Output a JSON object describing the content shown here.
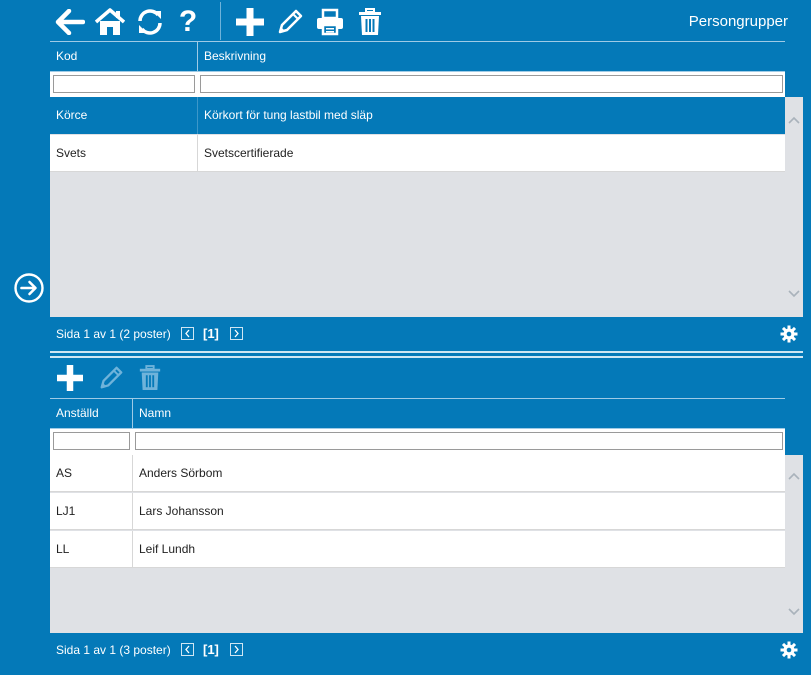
{
  "window": {
    "title": "Persongrupper"
  },
  "toolbar": {
    "buttons": [
      {
        "name": "back-button",
        "icon": "arrow-left-icon"
      },
      {
        "name": "home-button",
        "icon": "home-icon"
      },
      {
        "name": "refresh-button",
        "icon": "refresh-icon"
      },
      {
        "name": "help-button",
        "icon": "question-icon"
      },
      {
        "name": "add-button",
        "icon": "plus-icon"
      },
      {
        "name": "edit-button",
        "icon": "pencil-icon"
      },
      {
        "name": "print-button",
        "icon": "printer-icon"
      },
      {
        "name": "delete-button",
        "icon": "trash-icon"
      }
    ]
  },
  "side_nav": {
    "icon": "arrow-circle-right-icon"
  },
  "groups_grid": {
    "columns": [
      "Kod",
      "Beskrivning"
    ],
    "filter_values": [
      "",
      ""
    ],
    "rows": [
      {
        "kod": "Körce",
        "beskrivning": "Körkort för tung lastbil med släp",
        "selected": true
      },
      {
        "kod": "Svets",
        "beskrivning": "Svetscertifierade",
        "selected": false
      }
    ],
    "pager": {
      "text": "Sida 1 av 1 (2 poster)",
      "page": "[1]"
    }
  },
  "members_toolbar": {
    "buttons": [
      {
        "name": "add-member-button",
        "icon": "plus-icon",
        "enabled": true
      },
      {
        "name": "edit-member-button",
        "icon": "pencil-icon",
        "enabled": false
      },
      {
        "name": "delete-member-button",
        "icon": "trash-icon",
        "enabled": false
      }
    ]
  },
  "members_grid": {
    "columns": [
      "Anställd",
      "Namn"
    ],
    "filter_values": [
      "",
      ""
    ],
    "rows": [
      {
        "anstalld": "AS",
        "namn": "Anders Sörbom"
      },
      {
        "anstalld": "LJ1",
        "namn": "Lars Johansson"
      },
      {
        "anstalld": "LL",
        "namn": "Leif Lundh"
      }
    ],
    "pager": {
      "text": "Sida 1 av 1 (3 poster)",
      "page": "[1]"
    }
  },
  "colors": {
    "accent": "#0479b8",
    "empty_area": "#dfe1e5",
    "disabled_icon": "#6fb3da"
  }
}
